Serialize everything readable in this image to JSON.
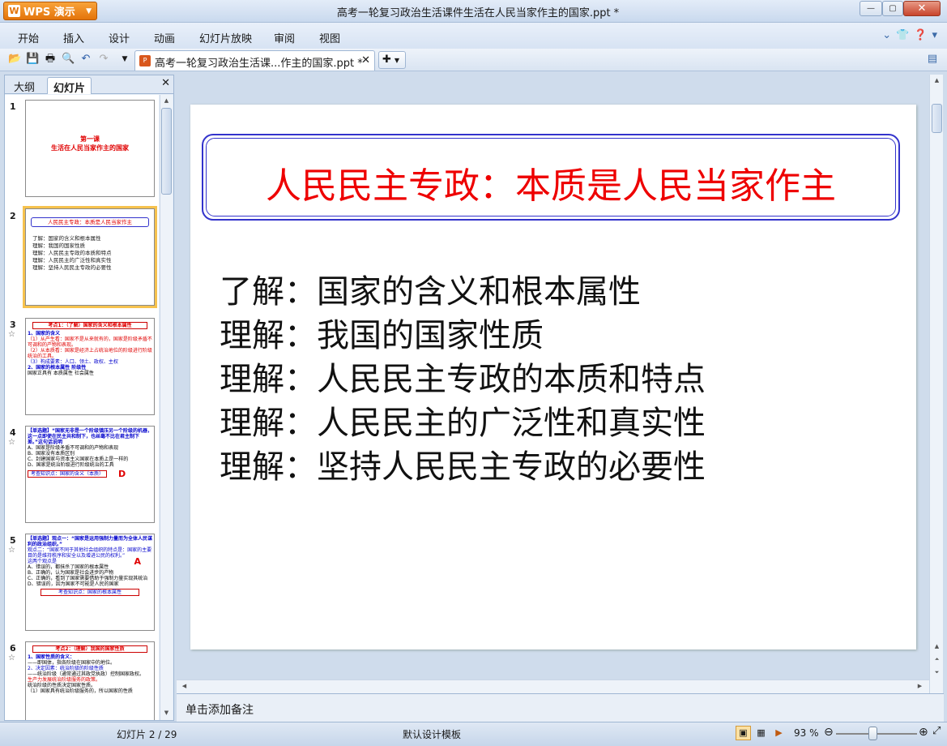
{
  "window": {
    "app_button": "WPS 演示",
    "title": "高考一轮复习政治生活课件生活在人民当家作主的国家.ppt *"
  },
  "menu": {
    "items": [
      "开始",
      "插入",
      "设计",
      "动画",
      "幻灯片放映",
      "审阅",
      "视图"
    ]
  },
  "document_tab": {
    "label": "高考一轮复习政治生活课...作主的国家.ppt *"
  },
  "left_panel": {
    "tabs": [
      "大纲",
      "幻灯片"
    ],
    "active_tab": "幻灯片"
  },
  "thumbnails": [
    {
      "num": "1",
      "lines": [
        "第一课",
        "生活在人民当家作主的国家"
      ]
    },
    {
      "num": "2",
      "title": "人民民主专政：本质是人民当家作主",
      "lines": [
        "了解：国家的含义和根本属性",
        "理解：我国的国家性质",
        "理解：人民民主专政的本质和特点",
        "理解：人民民主的广泛性和真实性",
        "理解：坚持人民民主专政的必要性"
      ]
    },
    {
      "num": "3",
      "title": "考点1：（了解）国家的含义和根本属性",
      "lines": [
        "1、国家的含义",
        "（1）从产生看：国家不是从来就有的，国家是阶级矛盾不可调和的产物和表现。",
        "（2）从本质看：国家是经济上占统治地位的阶级进行阶级统治的工具。",
        "（3）构成要素：人口、领土、政权、主权",
        "2、国家的根本属性 阶级性",
        "国家正具有 本质属性 社会属性"
      ]
    },
    {
      "num": "4",
      "lines": [
        "【单选题】“国家无非是一个阶级镇压另一个阶级的机器，这一点即使在民主共和制下，也丝毫不比在君主制下差。”这句话说明",
        "A、国家是阶级矛盾不可调和的产物和表现",
        "B、国家没有本质区别",
        "C、封建国家与资本主义国家在本质上是一样的",
        "D、国家是统治阶级进行阶级统治的工具",
        "考查知识点：国家的含义（本质）",
        "D"
      ]
    },
    {
      "num": "5",
      "lines": [
        "【单选题】观点一：“国家是运用强制力量而为全体人民谋利的政治组织。”",
        "观点二：“国家不同于其他社会组织的特点是：国家的主要目的是维持秩序和安全以及增进公民的权利。”",
        "这两个观点是",
        "A",
        "A、错误的，都抹杀了国家的根本属性",
        "B、正确的，认为国家是社会进步的产物",
        "C、正确的，看到了国家需要借助于强制力量实现其统治",
        "D、错误的，因为国家不可能是人民的国家",
        "考查知识点：国家的根本属性"
      ]
    },
    {
      "num": "6",
      "title": "考点2：（理解）我国的国家性质",
      "lines": [
        "1、国家性质的含义：",
        "——即国体，指各阶级在国家中的地位。",
        "2、决定因素：统治阶级的阶级性质",
        "——统治阶级（通常通过其政党执政）控制国家政权。",
        "生产力发展统治阶级服务的政策。",
        "统治阶级的性质决定国家性质。",
        "（1）国家具有统治阶级服务的，所以国家的性质"
      ]
    }
  ],
  "slide": {
    "title": "人民民主专政：本质是人民当家作主",
    "body": [
      "了解：国家的含义和根本属性",
      "理解：我国的国家性质",
      "理解：人民民主专政的本质和特点",
      "理解：人民民主的广泛性和真实性",
      "理解：坚持人民民主专政的必要性"
    ]
  },
  "notes_placeholder": "单击添加备注",
  "status": {
    "slide_counter": "幻灯片 2 / 29",
    "template": "默认设计模板",
    "zoom": "93 %"
  },
  "colors": {
    "title_red": "#ee0000",
    "title_border": "#3333cc",
    "selected_thumb": "#f6c24e"
  }
}
